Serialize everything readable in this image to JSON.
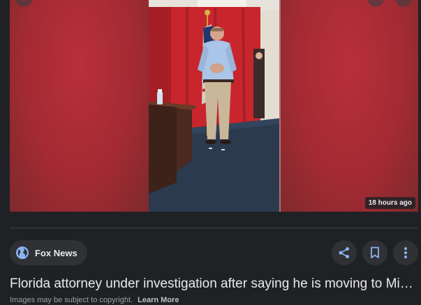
{
  "image": {
    "timestamp": "18 hours ago",
    "subject": "man-speaking-red-backdrop-photo"
  },
  "source": {
    "name": "Fox News",
    "icon": "globe-icon"
  },
  "actions": {
    "share_icon": "share-icon",
    "save_icon": "bookmark-icon",
    "more_icon": "more-vert-icon"
  },
  "article": {
    "title": "Florida attorney under investigation after saying he is moving to Miami"
  },
  "footer": {
    "copyright_text": "Images may be subject to copyright.",
    "learn_more": "Learn More"
  },
  "colors": {
    "background": "#202124",
    "chip": "#303134",
    "accent_icon": "#8ab4f8",
    "text": "#e8eaed",
    "muted": "#9aa0a6"
  }
}
